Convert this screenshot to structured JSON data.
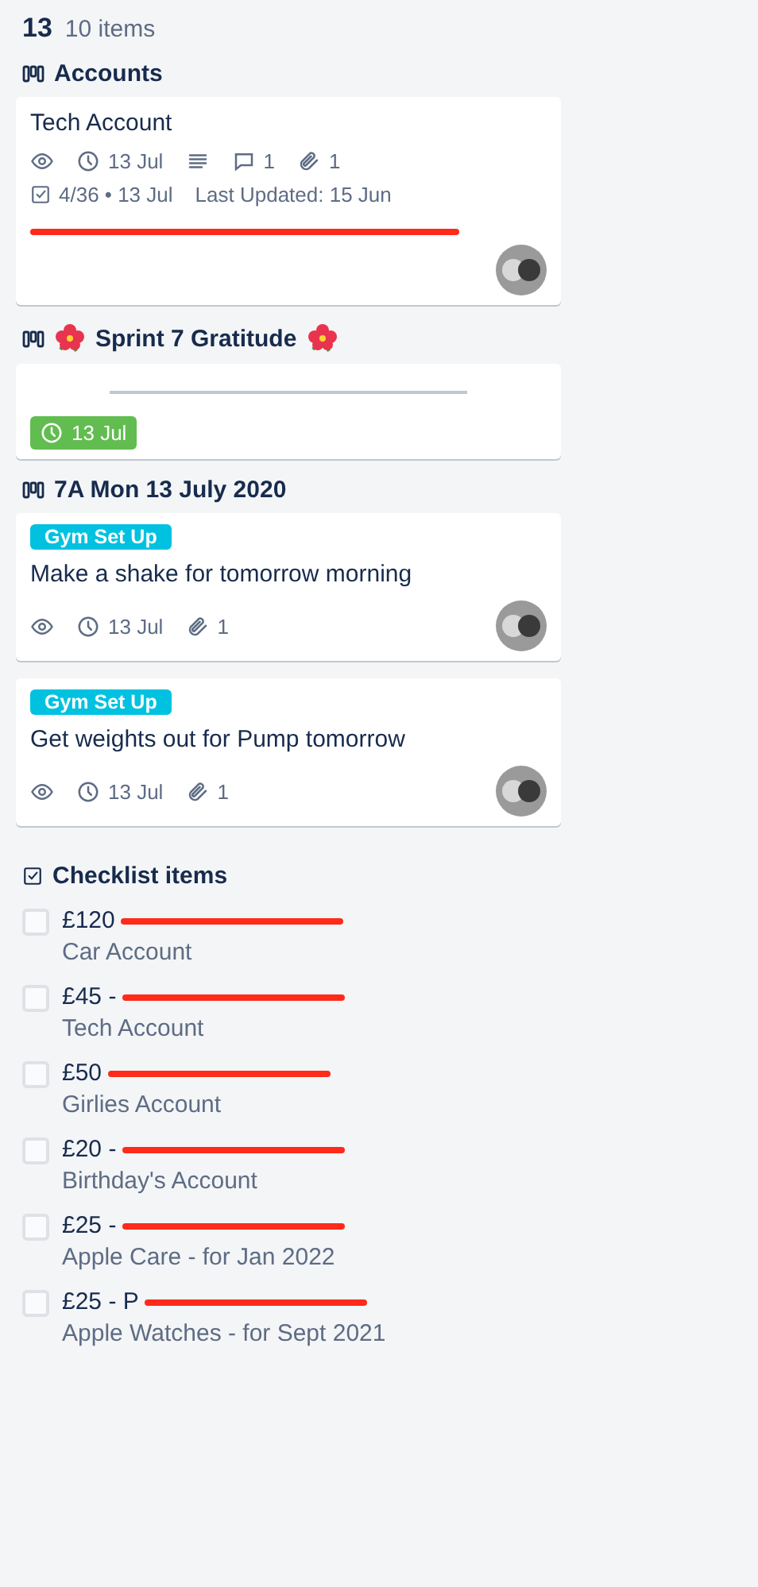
{
  "header": {
    "count": "13",
    "label": "10 items"
  },
  "groups": [
    {
      "title": "Accounts",
      "flowers": false,
      "cards": [
        {
          "kind": "task",
          "title": "Tech Account",
          "badges": [
            {
              "kind": "watch"
            },
            {
              "kind": "due",
              "text": "13 Jul"
            },
            {
              "kind": "description"
            },
            {
              "kind": "comments",
              "text": "1"
            },
            {
              "kind": "attachments",
              "text": "1"
            }
          ],
          "checklist": "4/36 • 13 Jul",
          "note": "Last Updated: 15 Jun",
          "redacted_line": true,
          "avatar": true
        }
      ]
    },
    {
      "title": "Sprint 7 Gratitude",
      "flowers": true,
      "cards": [
        {
          "kind": "divider",
          "due": "13 Jul",
          "due_done": true
        }
      ]
    },
    {
      "title": "7A Mon 13 July 2020",
      "flowers": false,
      "cards": [
        {
          "kind": "task",
          "labels": [
            {
              "text": "Gym Set Up",
              "color": "#00c2e0"
            }
          ],
          "title": "Make a shake for tomorrow morning",
          "badges": [
            {
              "kind": "watch"
            },
            {
              "kind": "due",
              "text": "13 Jul"
            },
            {
              "kind": "attachments",
              "text": "1"
            }
          ],
          "avatar": true
        },
        {
          "kind": "task",
          "labels": [
            {
              "text": "Gym Set Up",
              "color": "#00c2e0"
            }
          ],
          "title": "Get weights out for Pump tomorrow",
          "badges": [
            {
              "kind": "watch"
            },
            {
              "kind": "due",
              "text": "13 Jul"
            },
            {
              "kind": "attachments",
              "text": "1"
            }
          ],
          "avatar": true
        }
      ]
    }
  ],
  "checklist": {
    "title": "Checklist items",
    "items": [
      {
        "text": "£120",
        "subtitle": "Car Account",
        "checked": false
      },
      {
        "text": "£45 -",
        "subtitle": "Tech Account",
        "checked": false
      },
      {
        "text": "£50",
        "subtitle": "Girlies Account",
        "checked": false
      },
      {
        "text": "£20 -",
        "subtitle": "Birthday's Account",
        "checked": false
      },
      {
        "text": "£25 -",
        "subtitle": "Apple Care - for Jan 2022",
        "checked": false
      },
      {
        "text": "£25 - P",
        "subtitle": "Apple Watches - for Sept 2021",
        "checked": false
      }
    ]
  }
}
